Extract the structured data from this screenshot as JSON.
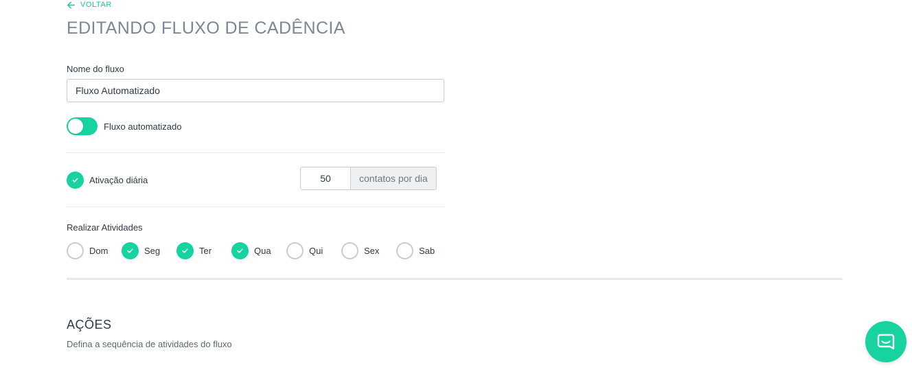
{
  "nav": {
    "back_label": "VOLTAR"
  },
  "page": {
    "title": "EDITANDO FLUXO DE CADÊNCIA"
  },
  "form": {
    "name_label": "Nome do fluxo",
    "name_value": "Fluxo Automatizado",
    "automated_toggle": {
      "label": "Fluxo automatizado",
      "on": true
    },
    "daily_activation": {
      "label": "Ativação diária",
      "checked": true,
      "count": "50",
      "unit": "contatos por dia"
    },
    "days_label": "Realizar Atividades",
    "days": [
      {
        "label": "Dom",
        "checked": false
      },
      {
        "label": "Seg",
        "checked": true
      },
      {
        "label": "Ter",
        "checked": true
      },
      {
        "label": "Qua",
        "checked": true
      },
      {
        "label": "Qui",
        "checked": false
      },
      {
        "label": "Sex",
        "checked": false
      },
      {
        "label": "Sab",
        "checked": false
      }
    ]
  },
  "actions": {
    "title": "AÇÕES",
    "subtitle": "Defina a sequência de atividades do fluxo"
  },
  "colors": {
    "accent": "#16d3a0",
    "title_gray": "#7b8894",
    "text": "#2e3a46",
    "border": "#c8cdd2"
  },
  "icons": {
    "back": "arrow-left-icon",
    "check": "check-icon",
    "chat": "chat-bubble-icon"
  }
}
